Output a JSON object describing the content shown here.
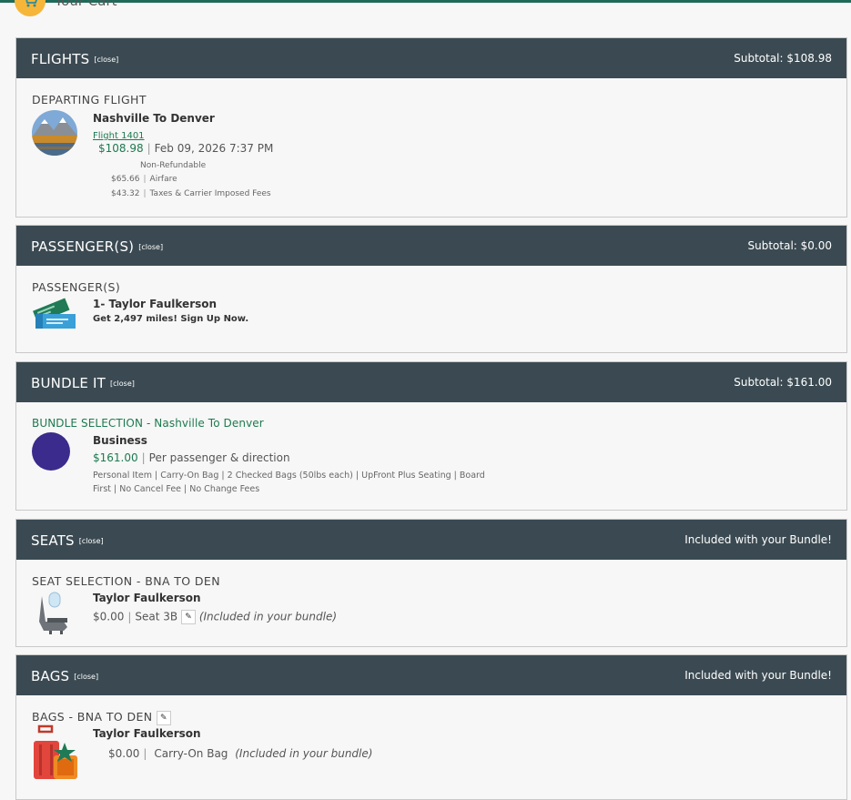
{
  "cart": {
    "title": "Your Cart"
  },
  "flights": {
    "title": "FLIGHTS",
    "close": "[close]",
    "subtotal": "Subtotal: $108.98",
    "label": "DEPARTING  FLIGHT",
    "route": "Nashville To Denver",
    "flight_link": "Flight 1401",
    "price": "$108.98",
    "datetime": "Feb 09, 2026 7:37 PM",
    "refund": "Non-Refundable",
    "airfare_amount": "$65.66",
    "airfare_label": "Airfare",
    "taxes_amount": "$43.32",
    "taxes_label": "Taxes & Carrier Imposed Fees"
  },
  "passengers": {
    "title": "PASSENGER(S)",
    "close": "[close]",
    "subtotal": "Subtotal: $0.00",
    "label": "PASSENGER(S)",
    "name": "1- Taylor Faulkerson",
    "miles": "Get 2,497 miles! Sign Up Now."
  },
  "bundle": {
    "title": "BUNDLE IT",
    "close": "[close]",
    "subtotal": "Subtotal: $161.00",
    "label": "BUNDLE SELECTION - Nashville To Denver",
    "tier": "Business",
    "price": "$161.00",
    "per": "Per passenger & direction",
    "features_line1": "Personal Item | Carry-On Bag | 2 Checked Bags (50lbs each) | UpFront Plus Seating | Board",
    "features_line2": "First | No Cancel Fee | No Change Fees",
    "badge_color": "#3a2b8c"
  },
  "seats": {
    "title": "SEATS",
    "close": "[close]",
    "subtotal": "Included with your Bundle!",
    "label": "SEAT SELECTION - BNA TO DEN",
    "name": "Taylor Faulkerson",
    "price": "$0.00",
    "seat": "Seat 3B",
    "note": "(Included in your bundle)"
  },
  "bags": {
    "title": "BAGS",
    "close": "[close]",
    "subtotal": "Included with your Bundle!",
    "label": "BAGS - BNA TO DEN",
    "name": "Taylor Faulkerson",
    "price": "$0.00",
    "bag": "Carry-On Bag",
    "note": "(Included in your bundle)"
  },
  "icons": {
    "cart": "shopping-cart-icon",
    "destination": "mountain-photo",
    "ticket": "ticket-icon",
    "seat": "airplane-seat-icon",
    "luggage": "luggage-icon",
    "edit": "pencil-icon"
  },
  "colors": {
    "header_bg": "#3b4a52",
    "accent_green": "#1d7a4f",
    "top_bar": "#1f6b5a"
  }
}
